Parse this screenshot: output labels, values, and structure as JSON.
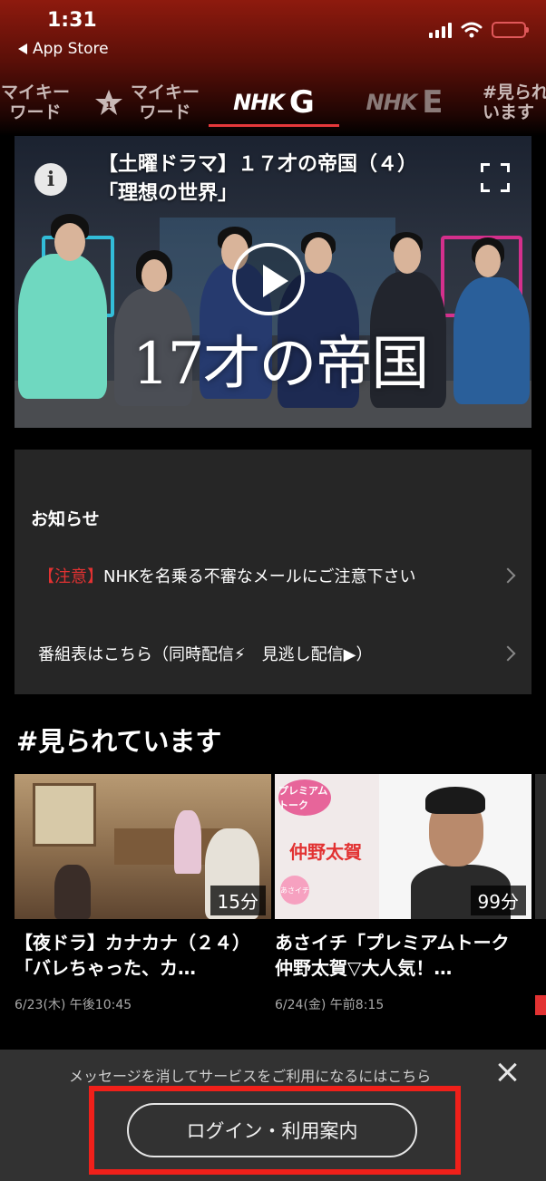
{
  "status_bar": {
    "time": "1:31",
    "back_label": "App Store"
  },
  "tabs": [
    {
      "label_line1": "マイキー",
      "label_line2": "ワード"
    },
    {
      "label_line1": "マイキー",
      "label_line2": "ワード",
      "icon": "star-one-icon"
    },
    {
      "logo": "NHK",
      "letter": "G",
      "active": true
    },
    {
      "logo": "NHK",
      "letter": "E"
    },
    {
      "label_line1": "#見られ",
      "label_line2": "います"
    }
  ],
  "hero": {
    "title_line1": "【土曜ドラマ】１７才の帝国（４）",
    "title_line2": "「理想の世界」",
    "logo_text": "17才の帝国"
  },
  "notices": {
    "heading": "お知らせ",
    "items": [
      {
        "tag": "【注意】",
        "text": "NHKを名乗る不審なメールにご注意下さい"
      },
      {
        "text": "番組表はこちら（同時配信⚡︎　見逃し配信▶︎）"
      }
    ]
  },
  "section": {
    "title": "#見られています"
  },
  "cards": [
    {
      "title": "【夜ドラ】カナカナ（２４）「バレちゃった、カ…",
      "duration": "15分",
      "date": "6/23(木) 午後10:45"
    },
    {
      "title": "あさイチ「プレミアムトーク　仲野太賀▽大人気！…",
      "duration": "99分",
      "date": "6/24(金) 午前8:15",
      "thumb_tag": "プレミアムトーク",
      "thumb_name": "仲野太賀",
      "thumb_badge": "あさイチ"
    }
  ],
  "bottom_bar": {
    "message": "メッセージを消してサービスをご利用になるにはこちら",
    "login_label": "ログイン・利用案内"
  },
  "colors": {
    "accent_red": "#e5383b",
    "warning": "#e23232"
  }
}
